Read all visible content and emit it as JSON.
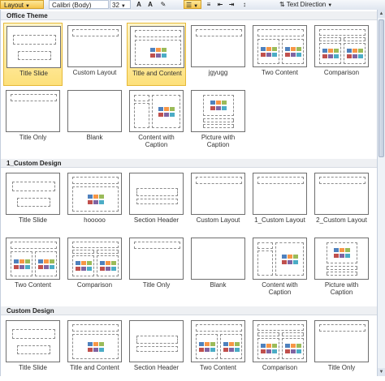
{
  "ribbon": {
    "layout_label": "Layout",
    "font_name": "Calibri (Body)",
    "font_size": "32",
    "text_direction": "Text Direction"
  },
  "sections": [
    {
      "title": "Office Theme",
      "layouts": [
        {
          "label": "Title Slide",
          "kind": "title-slide",
          "selected": true
        },
        {
          "label": "Custom Layout",
          "kind": "title-only"
        },
        {
          "label": "Title and Content",
          "kind": "title-content",
          "selected": true
        },
        {
          "label": "jgyugg",
          "kind": "title-only"
        },
        {
          "label": "Two Content",
          "kind": "two-content"
        },
        {
          "label": "Comparison",
          "kind": "comparison"
        },
        {
          "label": "Title Only",
          "kind": "title-only"
        },
        {
          "label": "Blank",
          "kind": "blank"
        },
        {
          "label": "Content with\nCaption",
          "kind": "content-caption"
        },
        {
          "label": "Picture with\nCaption",
          "kind": "picture-caption"
        }
      ]
    },
    {
      "title": "1_Custom Design",
      "layouts": [
        {
          "label": "Title Slide",
          "kind": "title-slide"
        },
        {
          "label": "hooooo",
          "kind": "title-content"
        },
        {
          "label": "Section Header",
          "kind": "section-header"
        },
        {
          "label": "Custom Layout",
          "kind": "title-only"
        },
        {
          "label": "1_Custom Layout",
          "kind": "title-only"
        },
        {
          "label": "2_Custom Layout",
          "kind": "title-only"
        },
        {
          "label": "Two Content",
          "kind": "two-content"
        },
        {
          "label": "Comparison",
          "kind": "comparison"
        },
        {
          "label": "Title Only",
          "kind": "title-only"
        },
        {
          "label": "Blank",
          "kind": "blank"
        },
        {
          "label": "Content with\nCaption",
          "kind": "content-caption"
        },
        {
          "label": "Picture with\nCaption",
          "kind": "picture-caption"
        }
      ]
    },
    {
      "title": "Custom Design",
      "layouts": [
        {
          "label": "Title Slide",
          "kind": "title-slide"
        },
        {
          "label": "Title and Content",
          "kind": "title-content"
        },
        {
          "label": "Section Header",
          "kind": "section-header"
        },
        {
          "label": "Two Content",
          "kind": "two-content"
        },
        {
          "label": "Comparison",
          "kind": "comparison"
        },
        {
          "label": "Title Only",
          "kind": "title-only"
        }
      ]
    }
  ],
  "colors": {
    "selected_top": "#fff6cc",
    "selected_bottom": "#fde07a",
    "selected_border": "#e6b938",
    "placeholder": "#8c8c8c"
  }
}
